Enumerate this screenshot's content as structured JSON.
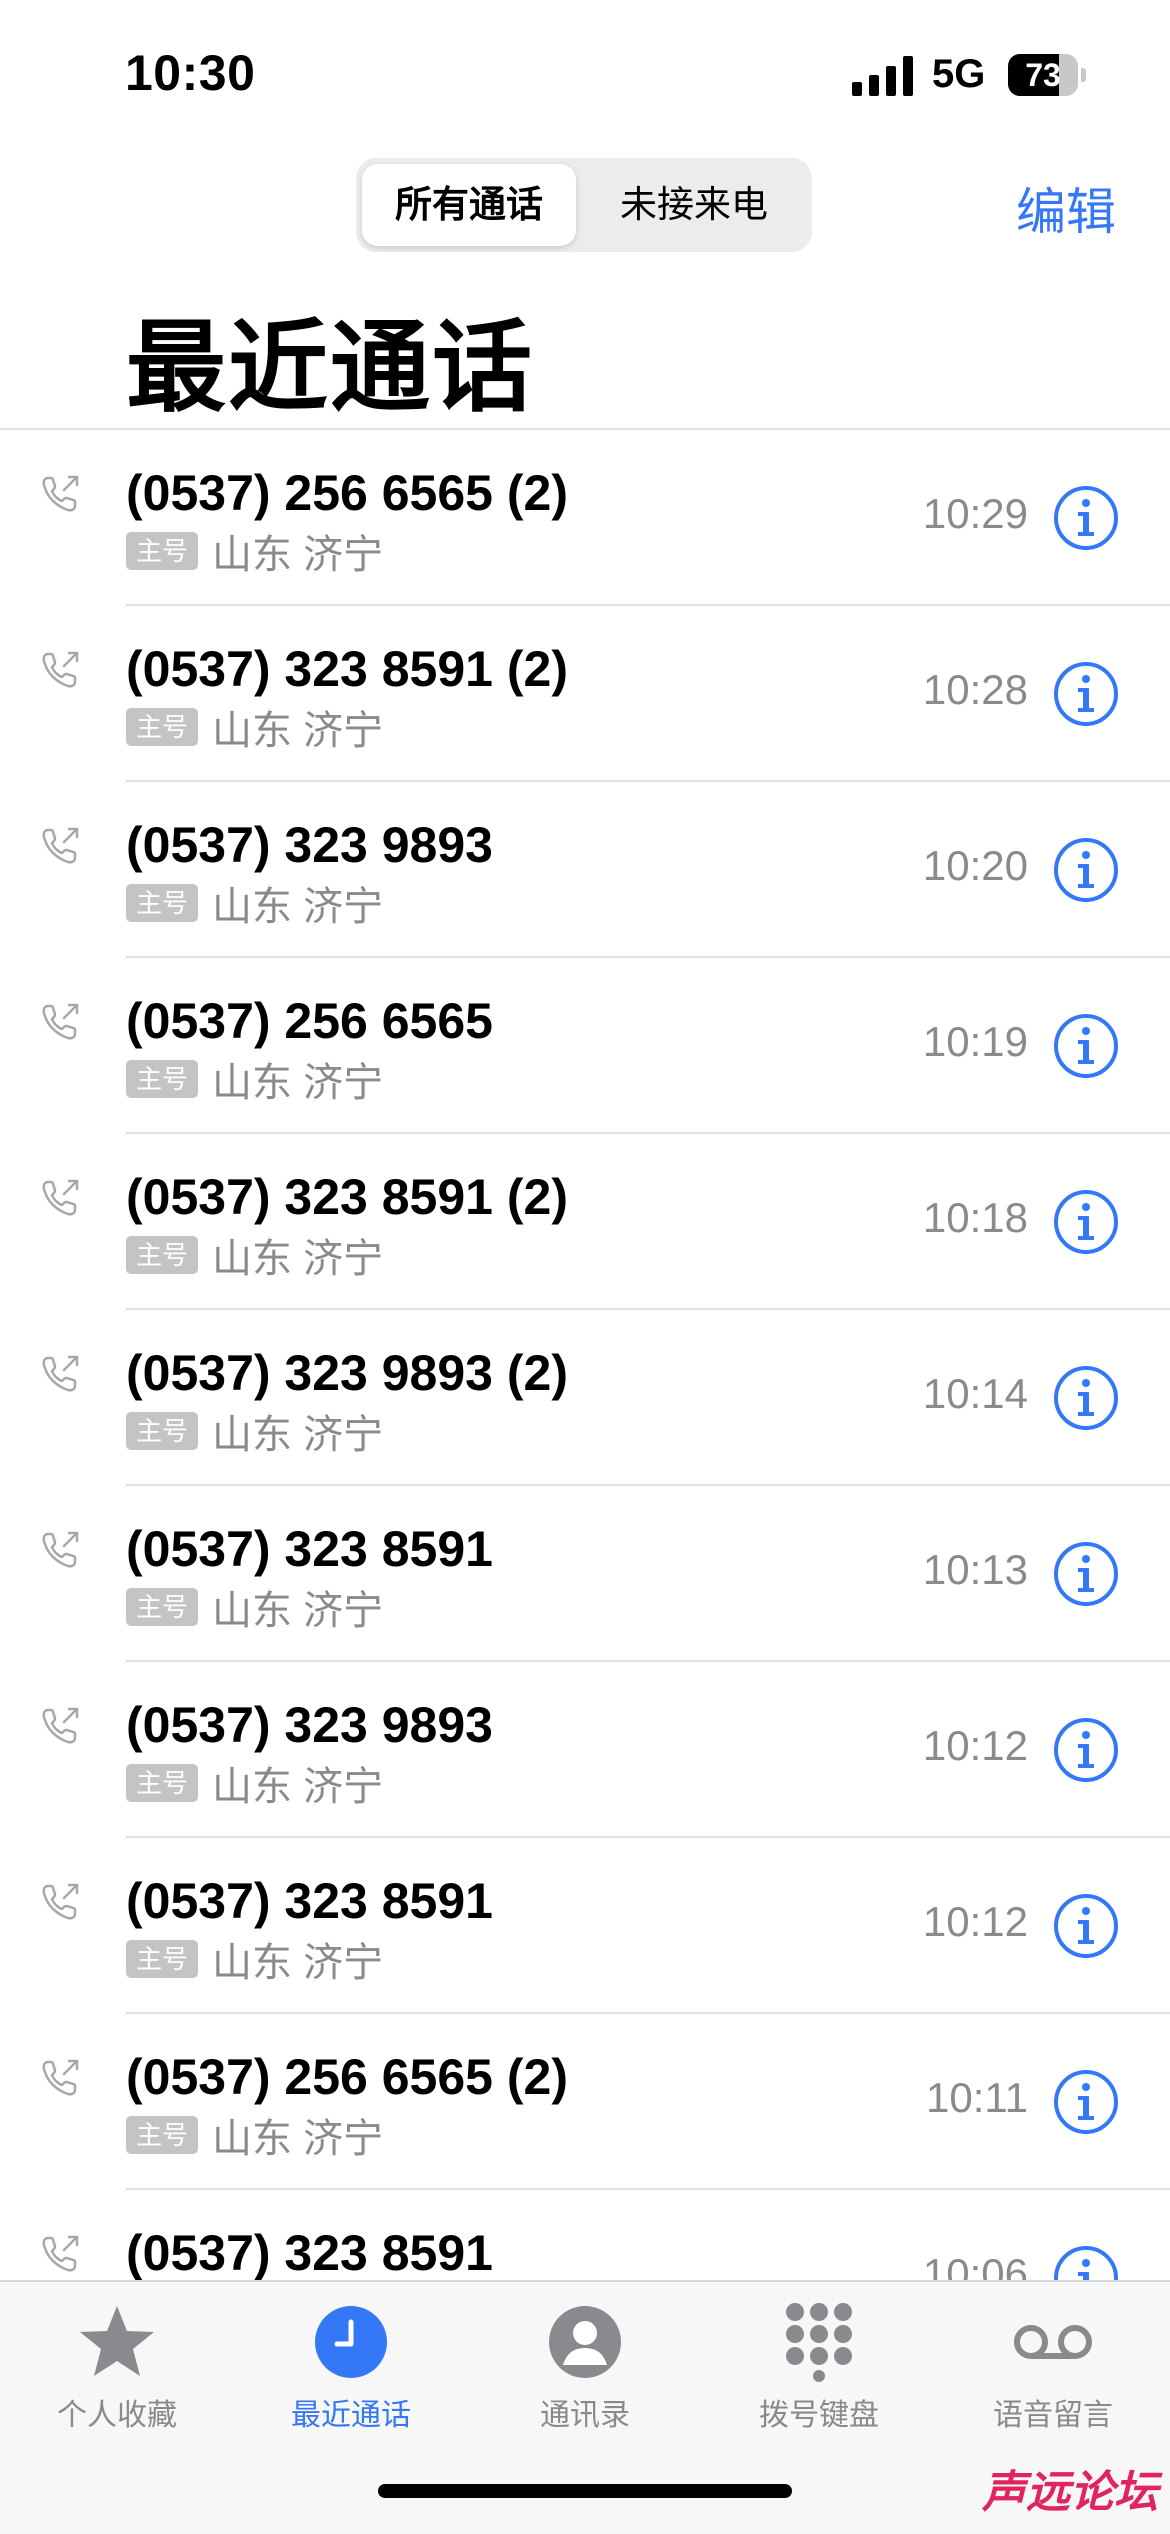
{
  "status_bar": {
    "time": "10:30",
    "network": "5G",
    "battery_percent": 73
  },
  "header": {
    "segments": [
      "所有通话",
      "未接来电"
    ],
    "selected_segment": "所有通话",
    "edit_label": "编辑",
    "title": "最近通话"
  },
  "call_label_badge": "主号",
  "calls": [
    {
      "number": "(0537) 256 6565 (2)",
      "location": "山东 济宁",
      "time": "10:29"
    },
    {
      "number": "(0537) 323 8591 (2)",
      "location": "山东 济宁",
      "time": "10:28"
    },
    {
      "number": "(0537) 323 9893",
      "location": "山东 济宁",
      "time": "10:20"
    },
    {
      "number": "(0537) 256 6565",
      "location": "山东 济宁",
      "time": "10:19"
    },
    {
      "number": "(0537) 323 8591 (2)",
      "location": "山东 济宁",
      "time": "10:18"
    },
    {
      "number": "(0537) 323 9893 (2)",
      "location": "山东 济宁",
      "time": "10:14"
    },
    {
      "number": "(0537) 323 8591",
      "location": "山东 济宁",
      "time": "10:13"
    },
    {
      "number": "(0537) 323 9893",
      "location": "山东 济宁",
      "time": "10:12"
    },
    {
      "number": "(0537) 323 8591",
      "location": "山东 济宁",
      "time": "10:12"
    },
    {
      "number": "(0537) 256 6565 (2)",
      "location": "山东 济宁",
      "time": "10:11"
    },
    {
      "number": "(0537) 323 8591",
      "location": "",
      "time": "10:06"
    }
  ],
  "tab_bar": {
    "tabs": [
      {
        "label": "个人收藏",
        "icon": "star-icon"
      },
      {
        "label": "最近通话",
        "icon": "clock-icon"
      },
      {
        "label": "通讯录",
        "icon": "contact-icon"
      },
      {
        "label": "拨号键盘",
        "icon": "keypad-icon"
      },
      {
        "label": "语音留言",
        "icon": "voicemail-icon"
      }
    ],
    "active_tab": "最近通话"
  },
  "watermark": "声远论坛",
  "colors": {
    "accent": "#3478f6",
    "secondary_text": "#8a8a8e",
    "badge_bg": "#c4c4c6"
  }
}
